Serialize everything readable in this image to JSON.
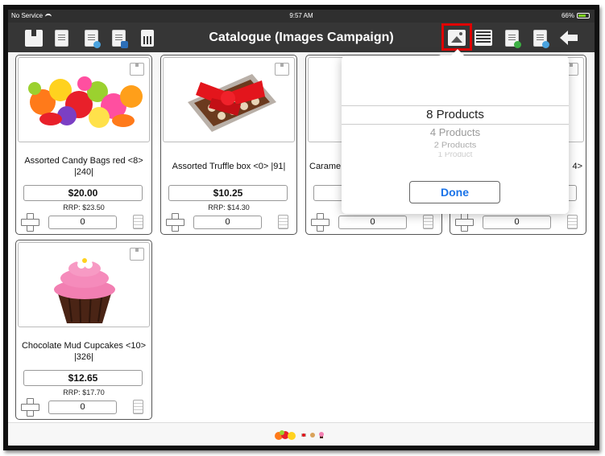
{
  "status_bar": {
    "carrier": "No Service",
    "time": "9:57 AM",
    "battery": "66%"
  },
  "nav": {
    "title": "Catalogue (Images Campaign)",
    "left_icons": [
      "box-icon",
      "document-icon",
      "document-upload-icon",
      "document-sale-icon",
      "calculator-icon"
    ],
    "right_icons": [
      "image-view-icon",
      "list-view-icon",
      "document-check-icon",
      "document-upload-icon",
      "back-arrow-icon"
    ]
  },
  "products": [
    {
      "name": "Assorted Candy Bags red <8> |240|",
      "price": "$20.00",
      "rrp": "RRP: $23.50",
      "qty": "0"
    },
    {
      "name": "Assorted Truffle box <0> |91|",
      "price": "$10.25",
      "rrp": "RRP: $14.30",
      "qty": "0"
    },
    {
      "name": "Carame",
      "price": "",
      "rrp": "",
      "qty": "0"
    },
    {
      "name": "4>",
      "price": "",
      "rrp": "",
      "qty": "0"
    },
    {
      "name": "Chocolate Mud Cupcakes <10> |326|",
      "price": "$12.65",
      "rrp": "RRP: $17.70",
      "qty": "0"
    }
  ],
  "picker": {
    "selected": "8 Products",
    "options": [
      "4 Products",
      "2 Products",
      "1 Product"
    ],
    "done_label": "Done"
  },
  "colors": {
    "highlight": "#e00000",
    "done_text": "#1a73e8",
    "navbar": "#363636"
  }
}
